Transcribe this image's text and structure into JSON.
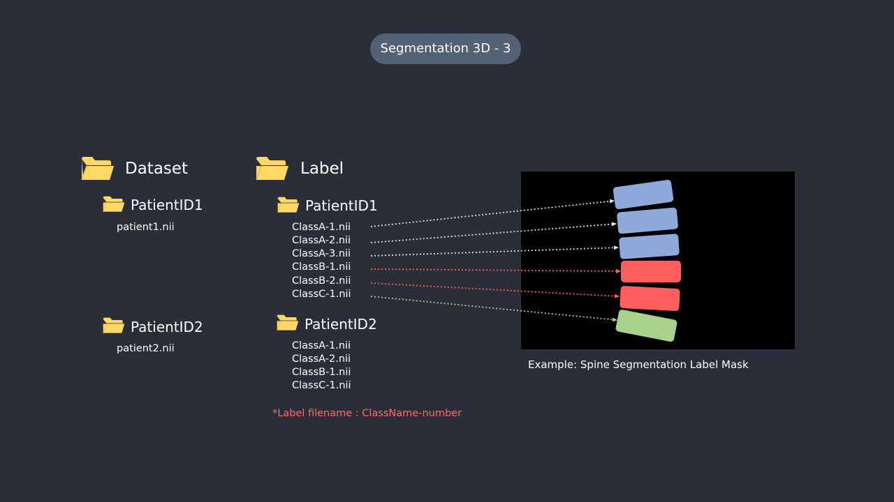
{
  "title": "Segmentation 3D - 3",
  "dataset": {
    "label": "Dataset",
    "patients": [
      {
        "name": "PatientID1",
        "file": "patient1.nii"
      },
      {
        "name": "PatientID2",
        "file": "patient2.nii"
      }
    ]
  },
  "label": {
    "label": "Label",
    "patients": [
      {
        "name": "PatientID1",
        "files": [
          "ClassA-1.nii",
          "ClassA-2.nii",
          "ClassA-3.nii",
          "ClassB-1.nii",
          "ClassB-2.nii",
          "ClassC-1.nii"
        ]
      },
      {
        "name": "PatientID2",
        "files": [
          "ClassA-1.nii",
          "ClassA-2.nii",
          "ClassB-1.nii",
          "ClassC-1.nii"
        ]
      }
    ],
    "note": "*Label filename : ClassName-number"
  },
  "mask": {
    "caption": "Example: Spine Segmentation Label Mask",
    "vertebrae_classes": [
      "ClassA",
      "ClassA",
      "ClassA",
      "ClassB",
      "ClassB",
      "ClassC"
    ]
  },
  "colors": {
    "background": "#2a2e38",
    "pill": "#526274",
    "folder": "#ffd866",
    "classA": "#8eaadb",
    "classB": "#ff5f5f",
    "classC": "#a9d18e",
    "note": "#ff6b6b",
    "connectorA": "#dde4f0"
  },
  "icons": {
    "folder": "folder-icon"
  }
}
